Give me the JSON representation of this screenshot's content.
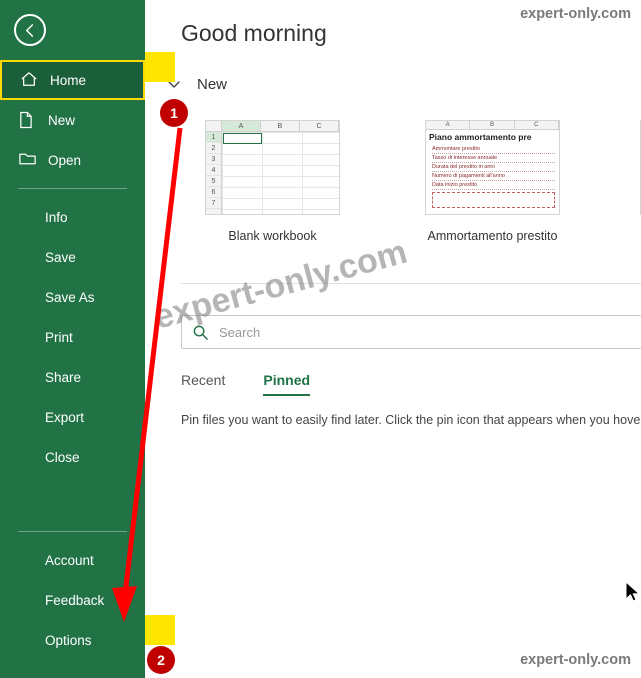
{
  "app": {
    "greeting": "Good morning",
    "back_icon": "back-arrow-icon"
  },
  "sidebar": {
    "top_items": [
      {
        "label": "Home",
        "icon": "home-icon",
        "selected": true
      },
      {
        "label": "New",
        "icon": "new-document-icon",
        "selected": false
      },
      {
        "label": "Open",
        "icon": "open-folder-icon",
        "selected": false
      }
    ],
    "middle_items": [
      {
        "label": "Info"
      },
      {
        "label": "Save"
      },
      {
        "label": "Save As"
      },
      {
        "label": "Print"
      },
      {
        "label": "Share"
      },
      {
        "label": "Export"
      },
      {
        "label": "Close"
      }
    ],
    "bottom_items": [
      {
        "label": "Account"
      },
      {
        "label": "Feedback"
      },
      {
        "label": "Options"
      }
    ]
  },
  "new_section": {
    "chevron_icon": "chevron-down-icon",
    "label": "New",
    "templates": [
      {
        "caption": "Blank workbook",
        "columns": [
          "A",
          "B",
          "C"
        ],
        "rows": [
          "1",
          "2",
          "3",
          "4",
          "5",
          "6",
          "7"
        ]
      },
      {
        "caption": "Ammortamento prestito",
        "title": "Piano ammortamento pre",
        "columns": [
          "A",
          "B",
          "C"
        ],
        "lines": [
          "Ammontare prestito",
          "Tasso di interesse annuale",
          "Durata del prestito in anni",
          "Numero di pagamenti all'anno",
          "Data inizio prestito"
        ]
      },
      {
        "caption": ""
      }
    ]
  },
  "search": {
    "placeholder": "Search",
    "icon": "search-icon"
  },
  "tabs": [
    {
      "label": "Recent",
      "active": false
    },
    {
      "label": "Pinned",
      "active": true
    }
  ],
  "pin_hint": "Pin files you want to easily find later. Click the pin icon that appears when you hover ov",
  "watermarks": {
    "top_right": "expert-only.com",
    "bottom_right": "expert-only.com",
    "diagonal": "expert-only.com"
  },
  "annotations": {
    "step1": "1",
    "step2": "2",
    "highlight_color": "#ffe600",
    "badge_color": "#c00000",
    "arrow_color": "#ff0000"
  },
  "theme": {
    "sidebar_bg": "#217346",
    "accent": "#217346",
    "selected_border": "#ffd800"
  }
}
